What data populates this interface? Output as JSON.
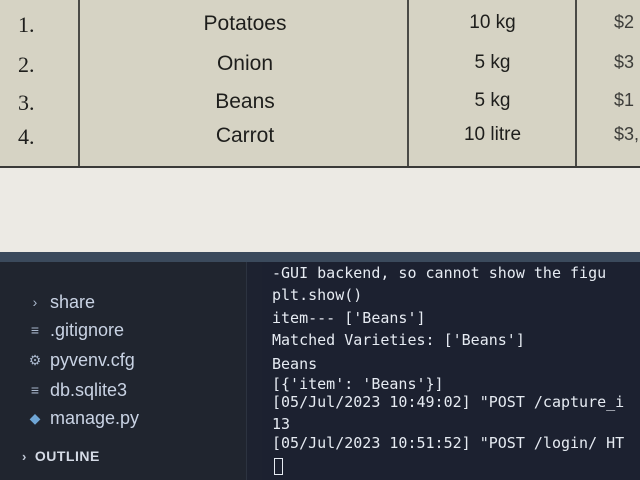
{
  "table": {
    "rows": [
      {
        "no": "1.",
        "item": "Potatoes",
        "qty": "10 kg",
        "price": "$2"
      },
      {
        "no": "2.",
        "item": "Onion",
        "qty": "5 kg",
        "price": "$3"
      },
      {
        "no": "3.",
        "item": "Beans",
        "qty": "5 kg",
        "price": "$1"
      },
      {
        "no": "4.",
        "item": "Carrot",
        "qty": "10 litre",
        "price": "$3,"
      }
    ]
  },
  "sidebar": {
    "items": [
      {
        "label": "share",
        "icon": "chevron-right-icon"
      },
      {
        "label": ".gitignore",
        "icon": "lines-file-icon"
      },
      {
        "label": "pyvenv.cfg",
        "icon": "gear-icon"
      },
      {
        "label": "db.sqlite3",
        "icon": "lines-file-icon"
      },
      {
        "label": "manage.py",
        "icon": "python-icon"
      }
    ],
    "outline_label": "OUTLINE"
  },
  "terminal": {
    "lines": [
      "-GUI backend, so cannot show the figu",
      "  plt.show()",
      "item--- ['Beans']",
      "Matched Varieties: ['Beans']",
      "Beans",
      "[{'item': 'Beans'}]",
      "[05/Jul/2023 10:49:02] \"POST /capture_i",
      "13",
      "[05/Jul/2023 10:51:52] \"POST /login/ HT"
    ]
  }
}
